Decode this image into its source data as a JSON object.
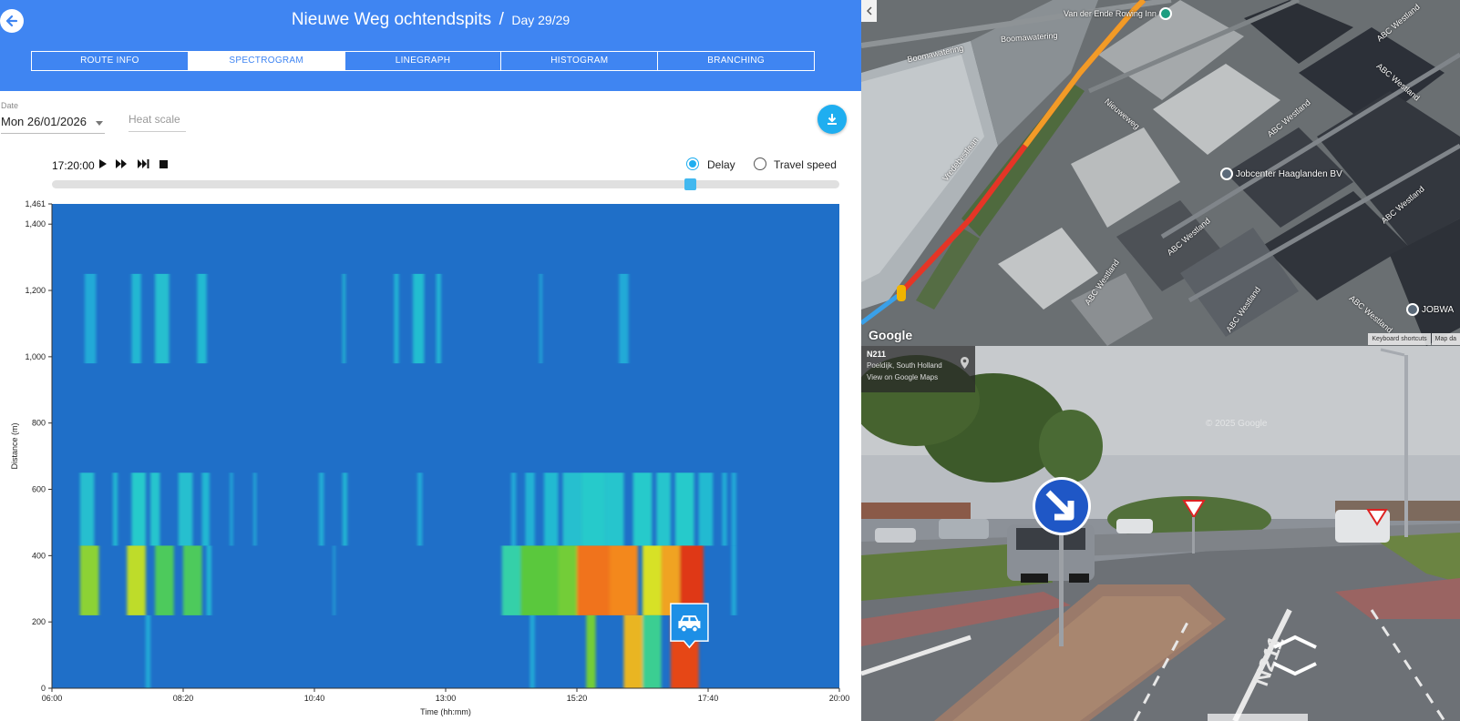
{
  "header": {
    "title": "Nieuwe Weg ochtendspits",
    "separator": "/",
    "day": "Day 29/29",
    "back_icon": "arrow-left-icon"
  },
  "tabs": [
    {
      "label": "ROUTE INFO",
      "active": false
    },
    {
      "label": "SPECTROGRAM",
      "active": true
    },
    {
      "label": "LINEGRAPH",
      "active": false
    },
    {
      "label": "HISTOGRAM",
      "active": false
    },
    {
      "label": "BRANCHING",
      "active": false
    }
  ],
  "controls": {
    "date_label": "Date",
    "date_value": "Mon 26/01/2026",
    "heat_scale_placeholder": "Heat scale",
    "download_icon": "download-icon",
    "time": "17:20:00",
    "playback_icons": [
      "play-icon",
      "fast-forward-icon",
      "skip-to-end-icon",
      "stop-icon"
    ],
    "radio_delay": "Delay",
    "radio_speed": "Travel speed",
    "selected_mode": "Delay",
    "slider_fraction": 0.81
  },
  "colors": {
    "header_bg": "#3f85f2",
    "accent": "#1faef0",
    "chart_bg": "#1f6fc8"
  },
  "chart_data": {
    "type": "heatmap",
    "title": "",
    "xlabel": "Time (hh:mm)",
    "ylabel": "Distance (m)",
    "x_ticks": [
      "06:00",
      "08:20",
      "10:40",
      "13:00",
      "15:20",
      "17:40",
      "20:00"
    ],
    "y_ticks": [
      "0",
      "200",
      "400",
      "600",
      "800",
      "1,000",
      "1,200",
      "1,400",
      "1,461"
    ],
    "xlim": [
      "06:00",
      "20:00"
    ],
    "ylim": [
      0,
      1461
    ],
    "color_scale": "0 = blue (no delay) -> cyan -> green -> yellow -> orange -> red (max delay)",
    "current_time_marker": {
      "time": "17:20",
      "distance_m": 200,
      "icon": "car-icon"
    },
    "cells": [
      {
        "t0": "06:35",
        "t1": "06:47",
        "d0": 980,
        "d1": 1250,
        "v": 0.3
      },
      {
        "t0": "07:25",
        "t1": "07:35",
        "d0": 980,
        "d1": 1250,
        "v": 0.35
      },
      {
        "t0": "07:50",
        "t1": "08:05",
        "d0": 980,
        "d1": 1250,
        "v": 0.38
      },
      {
        "t0": "08:35",
        "t1": "08:45",
        "d0": 980,
        "d1": 1250,
        "v": 0.36
      },
      {
        "t0": "11:10",
        "t1": "11:13",
        "d0": 980,
        "d1": 1250,
        "v": 0.35
      },
      {
        "t0": "12:05",
        "t1": "12:10",
        "d0": 980,
        "d1": 1250,
        "v": 0.33
      },
      {
        "t0": "12:25",
        "t1": "12:37",
        "d0": 980,
        "d1": 1250,
        "v": 0.37
      },
      {
        "t0": "12:50",
        "t1": "12:55",
        "d0": 980,
        "d1": 1250,
        "v": 0.34
      },
      {
        "t0": "14:40",
        "t1": "14:43",
        "d0": 980,
        "d1": 1250,
        "v": 0.28
      },
      {
        "t0": "16:05",
        "t1": "16:15",
        "d0": 980,
        "d1": 1250,
        "v": 0.3
      },
      {
        "t0": "06:30",
        "t1": "06:45",
        "d0": 430,
        "d1": 650,
        "v": 0.38
      },
      {
        "t0": "07:05",
        "t1": "07:10",
        "d0": 430,
        "d1": 650,
        "v": 0.35
      },
      {
        "t0": "07:25",
        "t1": "07:40",
        "d0": 430,
        "d1": 650,
        "v": 0.42
      },
      {
        "t0": "07:45",
        "t1": "07:55",
        "d0": 430,
        "d1": 650,
        "v": 0.4
      },
      {
        "t0": "08:15",
        "t1": "08:30",
        "d0": 430,
        "d1": 650,
        "v": 0.38
      },
      {
        "t0": "08:40",
        "t1": "08:48",
        "d0": 430,
        "d1": 650,
        "v": 0.35
      },
      {
        "t0": "09:10",
        "t1": "09:13",
        "d0": 430,
        "d1": 650,
        "v": 0.3
      },
      {
        "t0": "09:35",
        "t1": "09:38",
        "d0": 430,
        "d1": 650,
        "v": 0.3
      },
      {
        "t0": "10:45",
        "t1": "10:50",
        "d0": 430,
        "d1": 650,
        "v": 0.32
      },
      {
        "t0": "11:10",
        "t1": "11:15",
        "d0": 430,
        "d1": 650,
        "v": 0.34
      },
      {
        "t0": "12:30",
        "t1": "12:35",
        "d0": 430,
        "d1": 650,
        "v": 0.3
      },
      {
        "t0": "14:10",
        "t1": "14:15",
        "d0": 430,
        "d1": 650,
        "v": 0.3
      },
      {
        "t0": "14:25",
        "t1": "14:35",
        "d0": 430,
        "d1": 650,
        "v": 0.33
      },
      {
        "t0": "14:45",
        "t1": "15:00",
        "d0": 430,
        "d1": 650,
        "v": 0.36
      },
      {
        "t0": "15:05",
        "t1": "15:25",
        "d0": 430,
        "d1": 650,
        "v": 0.38
      },
      {
        "t0": "15:25",
        "t1": "15:50",
        "d0": 430,
        "d1": 650,
        "v": 0.42
      },
      {
        "t0": "15:50",
        "t1": "16:10",
        "d0": 430,
        "d1": 650,
        "v": 0.4
      },
      {
        "t0": "16:20",
        "t1": "16:40",
        "d0": 430,
        "d1": 650,
        "v": 0.42
      },
      {
        "t0": "16:45",
        "t1": "17:00",
        "d0": 430,
        "d1": 650,
        "v": 0.4
      },
      {
        "t0": "17:05",
        "t1": "17:25",
        "d0": 430,
        "d1": 650,
        "v": 0.42
      },
      {
        "t0": "17:30",
        "t1": "17:45",
        "d0": 430,
        "d1": 650,
        "v": 0.36
      },
      {
        "t0": "17:55",
        "t1": "18:00",
        "d0": 430,
        "d1": 650,
        "v": 0.32
      },
      {
        "t0": "18:05",
        "t1": "18:10",
        "d0": 430,
        "d1": 650,
        "v": 0.3
      },
      {
        "t0": "06:30",
        "t1": "06:50",
        "d0": 220,
        "d1": 430,
        "v": 0.62
      },
      {
        "t0": "07:20",
        "t1": "07:40",
        "d0": 220,
        "d1": 430,
        "v": 0.66
      },
      {
        "t0": "07:50",
        "t1": "08:10",
        "d0": 220,
        "d1": 430,
        "v": 0.55
      },
      {
        "t0": "08:20",
        "t1": "08:40",
        "d0": 220,
        "d1": 430,
        "v": 0.55
      },
      {
        "t0": "08:45",
        "t1": "08:50",
        "d0": 220,
        "d1": 430,
        "v": 0.35
      },
      {
        "t0": "11:00",
        "t1": "11:02",
        "d0": 220,
        "d1": 430,
        "v": 0.3
      },
      {
        "t0": "14:00",
        "t1": "14:20",
        "d0": 220,
        "d1": 430,
        "v": 0.48
      },
      {
        "t0": "14:20",
        "t1": "15:00",
        "d0": 220,
        "d1": 430,
        "v": 0.58
      },
      {
        "t0": "15:00",
        "t1": "15:20",
        "d0": 220,
        "d1": 430,
        "v": 0.6
      },
      {
        "t0": "15:20",
        "t1": "15:55",
        "d0": 220,
        "d1": 430,
        "v": 0.85
      },
      {
        "t0": "15:55",
        "t1": "16:25",
        "d0": 220,
        "d1": 430,
        "v": 0.82
      },
      {
        "t0": "16:30",
        "t1": "16:50",
        "d0": 220,
        "d1": 430,
        "v": 0.68
      },
      {
        "t0": "16:50",
        "t1": "17:10",
        "d0": 220,
        "d1": 430,
        "v": 0.78
      },
      {
        "t0": "17:10",
        "t1": "17:35",
        "d0": 220,
        "d1": 430,
        "v": 0.95
      },
      {
        "t0": "18:05",
        "t1": "18:10",
        "d0": 220,
        "d1": 430,
        "v": 0.3
      },
      {
        "t0": "07:40",
        "t1": "07:45",
        "d0": 0,
        "d1": 220,
        "v": 0.3
      },
      {
        "t0": "14:30",
        "t1": "14:35",
        "d0": 0,
        "d1": 220,
        "v": 0.3
      },
      {
        "t0": "15:30",
        "t1": "15:40",
        "d0": 0,
        "d1": 220,
        "v": 0.6
      },
      {
        "t0": "16:10",
        "t1": "16:30",
        "d0": 0,
        "d1": 220,
        "v": 0.75
      },
      {
        "t0": "16:30",
        "t1": "16:50",
        "d0": 0,
        "d1": 220,
        "v": 0.5
      },
      {
        "t0": "17:00",
        "t1": "17:30",
        "d0": 0,
        "d1": 220,
        "v": 0.92
      }
    ]
  },
  "map": {
    "labels": [
      "Boomawatering",
      "Boomawatering",
      "Vredebestlaan",
      "Nieuweweg",
      "ABC Westland",
      "ABC Westland",
      "ABC Westland",
      "ABC Westland",
      "ABC Westland",
      "ABC Westland",
      "ABC Westland",
      "ABC Westland"
    ],
    "pois": [
      "Van der Ende Rowing Inn",
      "Jobcenter Haaglanden BV",
      "JOBWA"
    ],
    "logo": "Google",
    "footer": [
      "Keyboard shortcuts",
      "Map da"
    ]
  },
  "street_view": {
    "road": "N211",
    "place": "Poeldijk, South Holland",
    "link": "View on Google Maps",
    "watermark": "© 2025 Google",
    "road_marking": "N211"
  }
}
